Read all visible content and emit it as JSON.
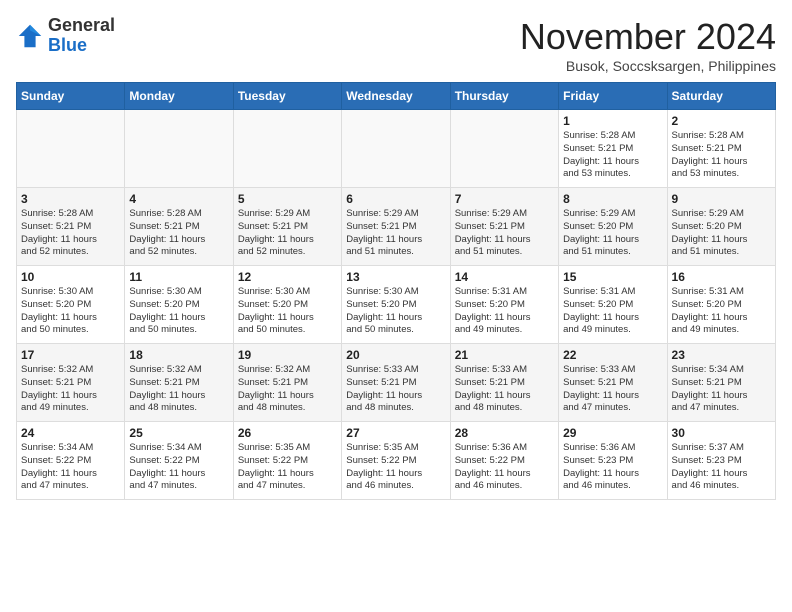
{
  "logo": {
    "general": "General",
    "blue": "Blue"
  },
  "title": "November 2024",
  "location": "Busok, Soccsksargen, Philippines",
  "weekdays": [
    "Sunday",
    "Monday",
    "Tuesday",
    "Wednesday",
    "Thursday",
    "Friday",
    "Saturday"
  ],
  "weeks": [
    [
      {
        "day": "",
        "info": ""
      },
      {
        "day": "",
        "info": ""
      },
      {
        "day": "",
        "info": ""
      },
      {
        "day": "",
        "info": ""
      },
      {
        "day": "",
        "info": ""
      },
      {
        "day": "1",
        "info": "Sunrise: 5:28 AM\nSunset: 5:21 PM\nDaylight: 11 hours\nand 53 minutes."
      },
      {
        "day": "2",
        "info": "Sunrise: 5:28 AM\nSunset: 5:21 PM\nDaylight: 11 hours\nand 53 minutes."
      }
    ],
    [
      {
        "day": "3",
        "info": "Sunrise: 5:28 AM\nSunset: 5:21 PM\nDaylight: 11 hours\nand 52 minutes."
      },
      {
        "day": "4",
        "info": "Sunrise: 5:28 AM\nSunset: 5:21 PM\nDaylight: 11 hours\nand 52 minutes."
      },
      {
        "day": "5",
        "info": "Sunrise: 5:29 AM\nSunset: 5:21 PM\nDaylight: 11 hours\nand 52 minutes."
      },
      {
        "day": "6",
        "info": "Sunrise: 5:29 AM\nSunset: 5:21 PM\nDaylight: 11 hours\nand 51 minutes."
      },
      {
        "day": "7",
        "info": "Sunrise: 5:29 AM\nSunset: 5:21 PM\nDaylight: 11 hours\nand 51 minutes."
      },
      {
        "day": "8",
        "info": "Sunrise: 5:29 AM\nSunset: 5:20 PM\nDaylight: 11 hours\nand 51 minutes."
      },
      {
        "day": "9",
        "info": "Sunrise: 5:29 AM\nSunset: 5:20 PM\nDaylight: 11 hours\nand 51 minutes."
      }
    ],
    [
      {
        "day": "10",
        "info": "Sunrise: 5:30 AM\nSunset: 5:20 PM\nDaylight: 11 hours\nand 50 minutes."
      },
      {
        "day": "11",
        "info": "Sunrise: 5:30 AM\nSunset: 5:20 PM\nDaylight: 11 hours\nand 50 minutes."
      },
      {
        "day": "12",
        "info": "Sunrise: 5:30 AM\nSunset: 5:20 PM\nDaylight: 11 hours\nand 50 minutes."
      },
      {
        "day": "13",
        "info": "Sunrise: 5:30 AM\nSunset: 5:20 PM\nDaylight: 11 hours\nand 50 minutes."
      },
      {
        "day": "14",
        "info": "Sunrise: 5:31 AM\nSunset: 5:20 PM\nDaylight: 11 hours\nand 49 minutes."
      },
      {
        "day": "15",
        "info": "Sunrise: 5:31 AM\nSunset: 5:20 PM\nDaylight: 11 hours\nand 49 minutes."
      },
      {
        "day": "16",
        "info": "Sunrise: 5:31 AM\nSunset: 5:20 PM\nDaylight: 11 hours\nand 49 minutes."
      }
    ],
    [
      {
        "day": "17",
        "info": "Sunrise: 5:32 AM\nSunset: 5:21 PM\nDaylight: 11 hours\nand 49 minutes."
      },
      {
        "day": "18",
        "info": "Sunrise: 5:32 AM\nSunset: 5:21 PM\nDaylight: 11 hours\nand 48 minutes."
      },
      {
        "day": "19",
        "info": "Sunrise: 5:32 AM\nSunset: 5:21 PM\nDaylight: 11 hours\nand 48 minutes."
      },
      {
        "day": "20",
        "info": "Sunrise: 5:33 AM\nSunset: 5:21 PM\nDaylight: 11 hours\nand 48 minutes."
      },
      {
        "day": "21",
        "info": "Sunrise: 5:33 AM\nSunset: 5:21 PM\nDaylight: 11 hours\nand 48 minutes."
      },
      {
        "day": "22",
        "info": "Sunrise: 5:33 AM\nSunset: 5:21 PM\nDaylight: 11 hours\nand 47 minutes."
      },
      {
        "day": "23",
        "info": "Sunrise: 5:34 AM\nSunset: 5:21 PM\nDaylight: 11 hours\nand 47 minutes."
      }
    ],
    [
      {
        "day": "24",
        "info": "Sunrise: 5:34 AM\nSunset: 5:22 PM\nDaylight: 11 hours\nand 47 minutes."
      },
      {
        "day": "25",
        "info": "Sunrise: 5:34 AM\nSunset: 5:22 PM\nDaylight: 11 hours\nand 47 minutes."
      },
      {
        "day": "26",
        "info": "Sunrise: 5:35 AM\nSunset: 5:22 PM\nDaylight: 11 hours\nand 47 minutes."
      },
      {
        "day": "27",
        "info": "Sunrise: 5:35 AM\nSunset: 5:22 PM\nDaylight: 11 hours\nand 46 minutes."
      },
      {
        "day": "28",
        "info": "Sunrise: 5:36 AM\nSunset: 5:22 PM\nDaylight: 11 hours\nand 46 minutes."
      },
      {
        "day": "29",
        "info": "Sunrise: 5:36 AM\nSunset: 5:23 PM\nDaylight: 11 hours\nand 46 minutes."
      },
      {
        "day": "30",
        "info": "Sunrise: 5:37 AM\nSunset: 5:23 PM\nDaylight: 11 hours\nand 46 minutes."
      }
    ]
  ]
}
